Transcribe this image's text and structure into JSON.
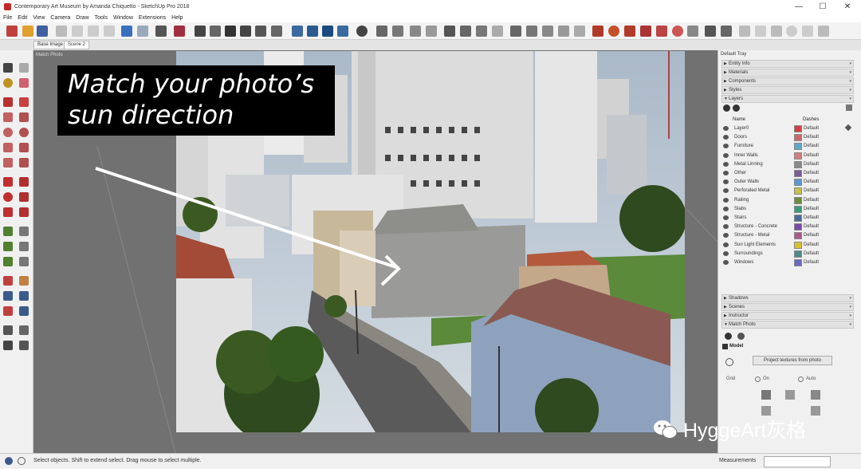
{
  "window": {
    "title": "Contemporary Art Museum by Amanda Chiquetto - SketchUp Pro 2018",
    "minimize": "—",
    "maximize": "☐",
    "close": "✕"
  },
  "menu": [
    "File",
    "Edit",
    "View",
    "Camera",
    "Draw",
    "Tools",
    "Window",
    "Extensions",
    "Help"
  ],
  "scene_tabs": [
    "Base Image",
    "Scene 2"
  ],
  "viewport": {
    "label": "Match Photo"
  },
  "callout": {
    "text": "Match your photo’s\nsun direction"
  },
  "tray": {
    "title": "Default Tray",
    "sections_top": [
      "Entity Info",
      "Materials",
      "Components",
      "Styles",
      "Layers"
    ],
    "layers_header": {
      "name": "Name",
      "dashes": "Dashes"
    },
    "layers": [
      {
        "name": "Layer0",
        "color": "#d04040",
        "dashes": "Default"
      },
      {
        "name": "Doors",
        "color": "#c86a6a",
        "dashes": "Default"
      },
      {
        "name": "Furniture",
        "color": "#5fa8c8",
        "dashes": "Default"
      },
      {
        "name": "Inner Walls",
        "color": "#d07f7f",
        "dashes": "Default"
      },
      {
        "name": "Metal Linning",
        "color": "#8a8a8a",
        "dashes": "Default"
      },
      {
        "name": "Other",
        "color": "#7a5c9a",
        "dashes": "Default"
      },
      {
        "name": "Outer Walls",
        "color": "#5a9ad0",
        "dashes": "Default"
      },
      {
        "name": "Perforated Metal",
        "color": "#c8c050",
        "dashes": "Default"
      },
      {
        "name": "Railing",
        "color": "#6c8d3c",
        "dashes": "Default"
      },
      {
        "name": "Slabs",
        "color": "#3a9a7a",
        "dashes": "Default"
      },
      {
        "name": "Stairs",
        "color": "#4a6a9a",
        "dashes": "Default"
      },
      {
        "name": "Structure - Concrete",
        "color": "#7a4aa8",
        "dashes": "Default"
      },
      {
        "name": "Structure - Metal",
        "color": "#a85a8a",
        "dashes": "Default"
      },
      {
        "name": "Sun Light Elements",
        "color": "#d8c030",
        "dashes": "Default"
      },
      {
        "name": "Surroundings",
        "color": "#4a8a8a",
        "dashes": "Default"
      },
      {
        "name": "Windows",
        "color": "#6a6ac0",
        "dashes": "Default"
      }
    ],
    "sections_bottom": [
      "Shadows",
      "Scenes",
      "Instructor",
      "Match Photo"
    ],
    "match_photo": {
      "model_label": "Model",
      "project_button": "Project textures from photo",
      "grid_label": "Grid",
      "opt_on": "On",
      "opt_auto": "Auto"
    }
  },
  "status": {
    "text": "Select objects. Shift to extend select. Drag mouse to select multiple.",
    "measurements": "Measurements"
  },
  "watermark": "HyggeArt灰格"
}
